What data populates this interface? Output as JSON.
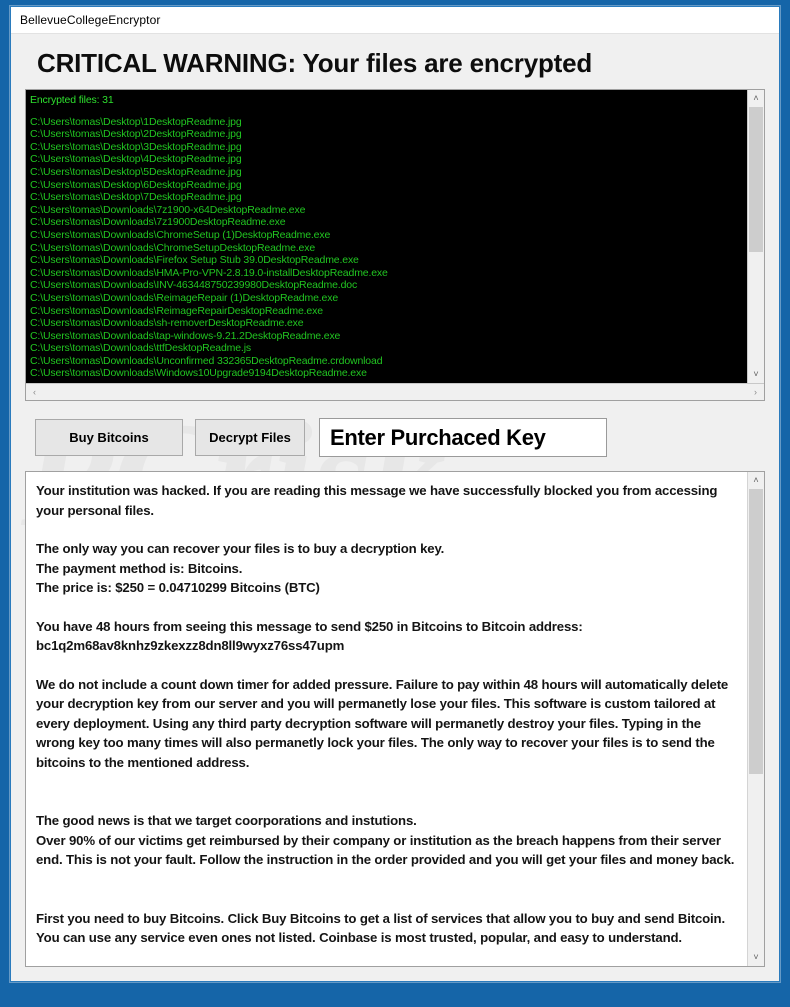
{
  "window": {
    "title": "BellevueCollegeEncryptor",
    "accent_color": "#1565a8",
    "client_bg": "#f0f0f0"
  },
  "heading": "CRITICAL WARNING: Your files are encrypted",
  "watermark": {
    "line1": "PCrisk",
    "line2": "com"
  },
  "file_list": {
    "console_bg": "#000000",
    "text_color": "#21c521",
    "count_label": "Encrypted files: 31",
    "files": [
      "C:\\Users\\tomas\\Desktop\\1DesktopReadme.jpg",
      "C:\\Users\\tomas\\Desktop\\2DesktopReadme.jpg",
      "C:\\Users\\tomas\\Desktop\\3DesktopReadme.jpg",
      "C:\\Users\\tomas\\Desktop\\4DesktopReadme.jpg",
      "C:\\Users\\tomas\\Desktop\\5DesktopReadme.jpg",
      "C:\\Users\\tomas\\Desktop\\6DesktopReadme.jpg",
      "C:\\Users\\tomas\\Desktop\\7DesktopReadme.jpg",
      "C:\\Users\\tomas\\Downloads\\7z1900-x64DesktopReadme.exe",
      "C:\\Users\\tomas\\Downloads\\7z1900DesktopReadme.exe",
      "C:\\Users\\tomas\\Downloads\\ChromeSetup (1)DesktopReadme.exe",
      "C:\\Users\\tomas\\Downloads\\ChromeSetupDesktopReadme.exe",
      "C:\\Users\\tomas\\Downloads\\Firefox Setup Stub 39.0DesktopReadme.exe",
      "C:\\Users\\tomas\\Downloads\\HMA-Pro-VPN-2.8.19.0-installDesktopReadme.exe",
      "C:\\Users\\tomas\\Downloads\\INV-463448750239980DesktopReadme.doc",
      "C:\\Users\\tomas\\Downloads\\ReimageRepair (1)DesktopReadme.exe",
      "C:\\Users\\tomas\\Downloads\\ReimageRepairDesktopReadme.exe",
      "C:\\Users\\tomas\\Downloads\\sh-removerDesktopReadme.exe",
      "C:\\Users\\tomas\\Downloads\\tap-windows-9.21.2DesktopReadme.exe",
      "C:\\Users\\tomas\\Downloads\\ttfDesktopReadme.js",
      "C:\\Users\\tomas\\Downloads\\Unconfirmed 332365DesktopReadme.crdownload",
      "C:\\Users\\tomas\\Downloads\\Windows10Upgrade9194DesktopReadme.exe"
    ]
  },
  "controls": {
    "buy_bitcoins_label": "Buy Bitcoins",
    "decrypt_files_label": "Decrypt Files",
    "key_input_value": "Enter Purchaced Key"
  },
  "message": {
    "p1": "Your institution was hacked. If you are reading this message we have successfully blocked you from accessing your personal files.",
    "p2": "The only way you can recover your files is to buy a decryption key.",
    "p3": "The payment method is: Bitcoins.",
    "p4": " The price is: $250 = 0.04710299 Bitcoins (BTC)",
    "p5": "You have 48 hours from seeing this message to send $250 in Bitcoins to Bitcoin address:",
    "bitcoin_address": "bc1q2m68av8knhz9zkexzz8dn8ll9wyxz76ss47upm",
    "p6": "We do not include a count down timer for added pressure. Failure to pay within 48 hours will automatically delete your decryption key from our server and you will permanetly lose your files. This software is custom tailored at every deployment. Using any third party decryption software will permanetly destroy your files. Typing in the wrong key too many times will also permanetly lock your files. The only way to recover your files is to send the bitcoins to the mentioned address.",
    "p7": "The good news is that we target coorporations and instutions.",
    "p8": "Over 90% of our victims get reimbursed by their company or institution as the breach happens from their server end. This is not your fault. Follow the instruction in the order provided and you will get your files and money back.",
    "p9": "First you need to buy Bitcoins. Click Buy Bitcoins to get a list of services that allow you to buy and send Bitcoin.",
    "p10": "You can use any service even ones not listed. Coinbase is most trusted, popular, and easy to understand."
  },
  "scrollbars": {
    "up_arrow": "˄",
    "down_arrow": "˅",
    "left_arrow": "‹",
    "right_arrow": "›"
  }
}
